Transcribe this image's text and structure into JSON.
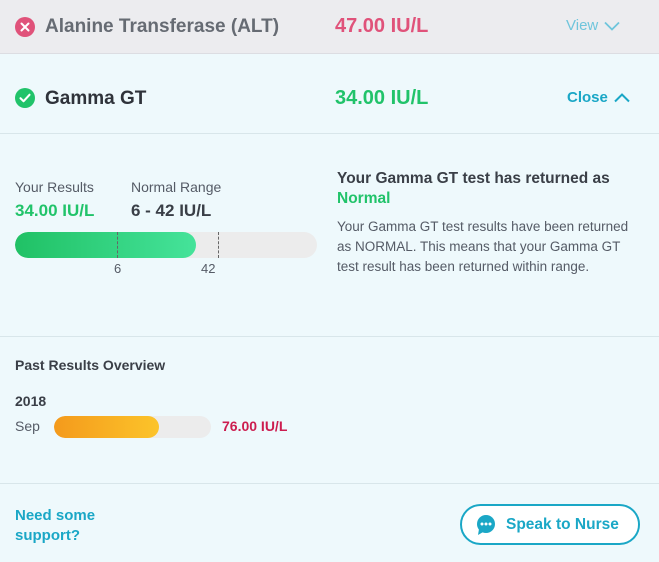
{
  "alt_row": {
    "title": "Alanine Transferase (ALT)",
    "value": "47.00 IU/L",
    "action_label": "View",
    "status": "abnormal",
    "icon": "x-circle-icon",
    "value_color": "#e0527a"
  },
  "ggt_row": {
    "title": "Gamma GT",
    "value": "34.00 IU/L",
    "action_label": "Close",
    "status": "normal",
    "icon": "check-circle-icon",
    "value_color": "#21c36a"
  },
  "details": {
    "your_results_label": "Your Results",
    "your_results_value": "34.00 IU/L",
    "normal_range_label": "Normal Range",
    "normal_range_value": "6 - 42 IU/L",
    "range_bar": {
      "min": 6,
      "max": 42,
      "min_label": "6",
      "max_label": "42",
      "result": 34
    },
    "message_title": "Your Gamma GT test has returned as",
    "message_status": "Normal",
    "message_body": "Your Gamma GT test results have been returned as NORMAL. This means that your Gamma GT test result has been returned within range."
  },
  "past_results": {
    "title": "Past Results Overview",
    "entries": [
      {
        "year": "2018",
        "month": "Sep",
        "value": "76.00 IU/L",
        "level_fraction": 0.67
      }
    ]
  },
  "footer": {
    "support_line1": "Need some",
    "support_line2": "support?",
    "nurse_button": "Speak to Nurse",
    "nurse_icon": "chat-bubble-icon"
  },
  "colors": {
    "accent": "#1aa7c6",
    "normal_green": "#21c36a",
    "abnormal_pink": "#e0527a",
    "past_value_red": "#cc1d4f",
    "orange": "#f7a11d"
  }
}
